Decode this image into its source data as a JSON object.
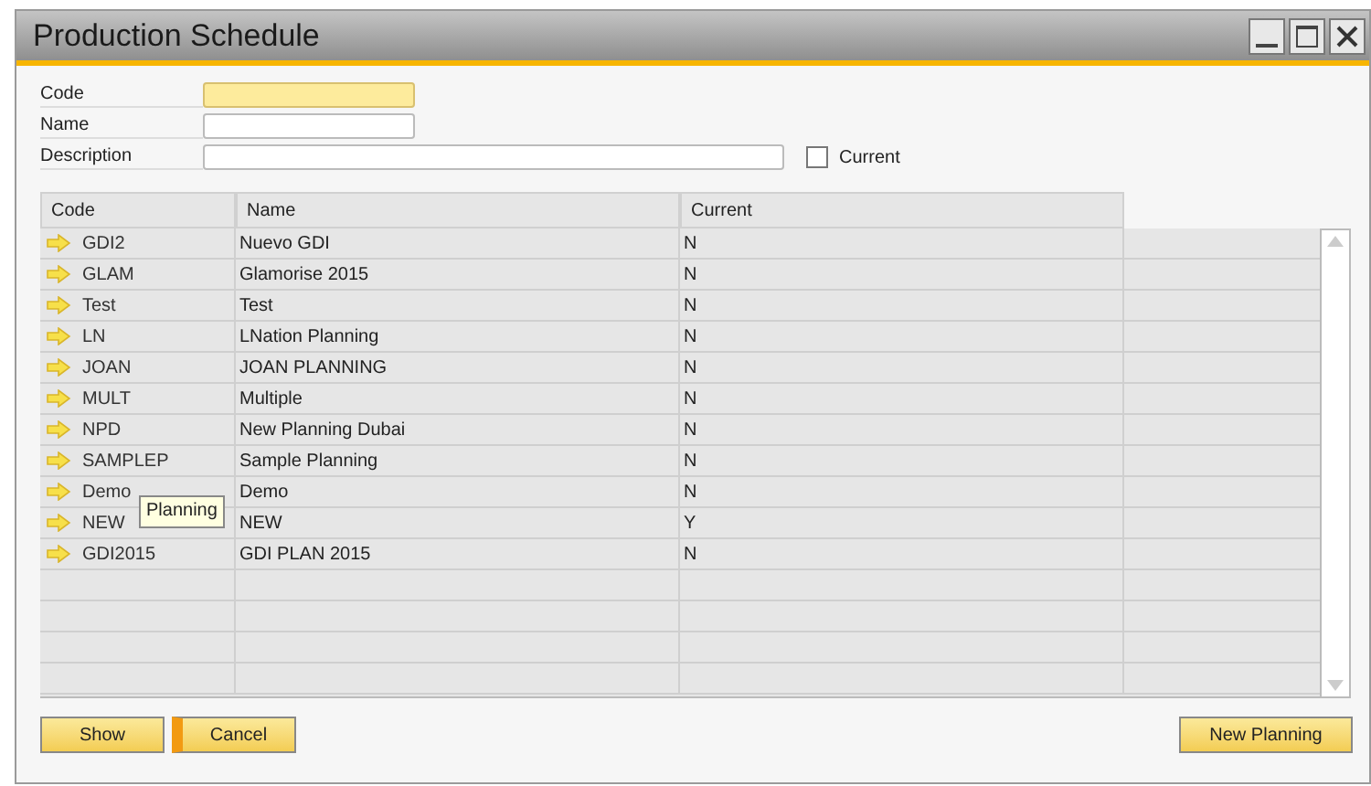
{
  "window": {
    "title": "Production Schedule"
  },
  "fields": [
    {
      "label": "Code",
      "focused": true,
      "wide": false
    },
    {
      "label": "Name",
      "focused": false,
      "wide": false
    },
    {
      "label": "Description",
      "focused": false,
      "wide": true
    }
  ],
  "current_checkbox": {
    "label": "Current",
    "checked": false
  },
  "table": {
    "columns": [
      "Code",
      "Name",
      "Current"
    ],
    "rows": [
      {
        "code": "GDI2",
        "name": "Nuevo GDI",
        "current": "N"
      },
      {
        "code": "GLAM",
        "name": "Glamorise 2015",
        "current": "N"
      },
      {
        "code": "Test",
        "name": "Test",
        "current": "N"
      },
      {
        "code": "LN",
        "name": "LNation Planning",
        "current": "N"
      },
      {
        "code": "JOAN",
        "name": "JOAN PLANNING",
        "current": "N"
      },
      {
        "code": "MULT",
        "name": "Multiple",
        "current": "N"
      },
      {
        "code": "NPD",
        "name": "New Planning Dubai",
        "current": "N"
      },
      {
        "code": "SAMPLEP",
        "name": "Sample Planning",
        "current": "N"
      },
      {
        "code": "Demo",
        "name": "Demo",
        "current": "N"
      },
      {
        "code": "NEW",
        "name": "NEW",
        "current": "Y"
      },
      {
        "code": "GDI2015",
        "name": "GDI PLAN 2015",
        "current": "N"
      }
    ]
  },
  "tooltip": {
    "text": "Planning"
  },
  "buttons": [
    {
      "label": "Show",
      "focused": false
    },
    {
      "label": "Cancel",
      "focused": true
    }
  ],
  "new_planning_button": {
    "label": "New Planning"
  }
}
